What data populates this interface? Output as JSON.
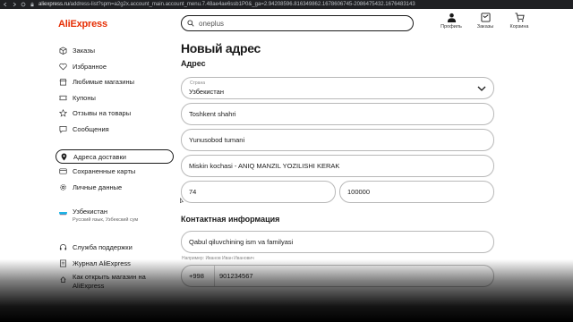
{
  "browser": {
    "url_host": "aliexpress.ru",
    "url_rest": "/address-list?spm=a2g2x.account_main.account_menu.7.48ae4ae6ssb1P0&_ga=2.94208596.816349862.1678606745-2086475432.1676483143"
  },
  "header": {
    "logo": "AliExpress",
    "search_value": "oneplus",
    "icons": [
      {
        "label": "Профиль",
        "icon": "person-icon"
      },
      {
        "label": "Заказы",
        "icon": "orders-icon"
      },
      {
        "label": "Корзина",
        "icon": "cart-icon"
      }
    ]
  },
  "sidebar": {
    "items": [
      {
        "label": "Заказы",
        "icon": "box-icon"
      },
      {
        "label": "Избранное",
        "icon": "heart-icon"
      },
      {
        "label": "Любимые магазины",
        "icon": "store-icon"
      },
      {
        "label": "Купоны",
        "icon": "coupon-icon"
      },
      {
        "label": "Отзывы на товары",
        "icon": "star-icon"
      },
      {
        "label": "Сообщения",
        "icon": "message-icon"
      }
    ],
    "items2": [
      {
        "label": "Адреса доставки",
        "icon": "location-icon",
        "active": true
      },
      {
        "label": "Сохраненные карты",
        "icon": "card-icon"
      },
      {
        "label": "Личные данные",
        "icon": "gear-icon"
      }
    ],
    "region": {
      "country": "Узбекистан",
      "details": "Русский язык, Узбекский сум"
    },
    "items3": [
      {
        "label": "Служба поддержки",
        "icon": "headset-icon"
      },
      {
        "label": "Журнал AliExpress",
        "icon": "journal-icon"
      },
      {
        "label": "Как открыть магазин на AliExpress",
        "icon": "shop-icon"
      }
    ]
  },
  "main": {
    "title": "Новый адрес",
    "address_title": "Адрес",
    "country_label": "Страна",
    "country_value": "Узбекистан",
    "region_value": "Toshkent shahri",
    "district_value": "Yunusobod tumani",
    "street_value": "Miskin kochasi - ANIQ MANZIL YOZILISHI KERAK",
    "house_value": "74",
    "postcode_value": "100000",
    "contact_title": "Контактная информация",
    "name_value": "Qabul qiluvchining ism va familyasi",
    "name_hint": "Например: Иванов Иван Иванович",
    "phone_code": "+998",
    "phone_value": "901234567"
  }
}
